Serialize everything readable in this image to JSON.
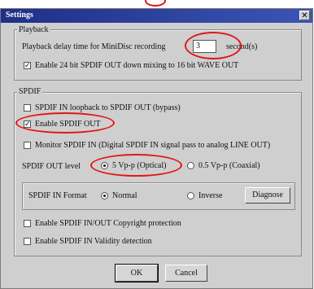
{
  "window": {
    "title": "Settings",
    "close_glyph": "✕"
  },
  "playback": {
    "label": "Playback",
    "delay_label": "Playback delay time for MiniDisc recording",
    "delay_value": "3",
    "delay_unit": "second(s)",
    "enable_24bit_label": "Enable 24 bit SPDIF OUT down mixing to 16 bit WAVE OUT",
    "enable_24bit_checked": true
  },
  "spdif": {
    "label": "SPDIF",
    "loopback_label": "SPDIF IN loopback to SPDIF OUT (bypass)",
    "loopback_checked": false,
    "enable_out_label": "Enable SPDIF OUT",
    "enable_out_checked": true,
    "monitor_label": "Monitor SPDIF IN  (Digital SPDIF IN signal pass to analog LINE OUT)",
    "monitor_checked": false,
    "out_level_label": "SPDIF OUT level",
    "out_level_options": [
      "5 Vp-p (Optical)",
      "0.5 Vp-p (Coaxial)"
    ],
    "out_level_selected": "5 Vp-p (Optical)",
    "format_label": "SPDIF IN Format",
    "format_options": [
      "Normal",
      "Inverse"
    ],
    "format_selected": "Normal",
    "diagnose_label": "Diagnose",
    "copyright_label": "Enable SPDIF IN/OUT Copyright protection",
    "copyright_checked": false,
    "validity_label": "Enable SPDIF IN Validity detection",
    "validity_checked": false
  },
  "buttons": {
    "ok_label": "OK",
    "cancel_label": "Cancel"
  },
  "annotation_color": "#e01818"
}
